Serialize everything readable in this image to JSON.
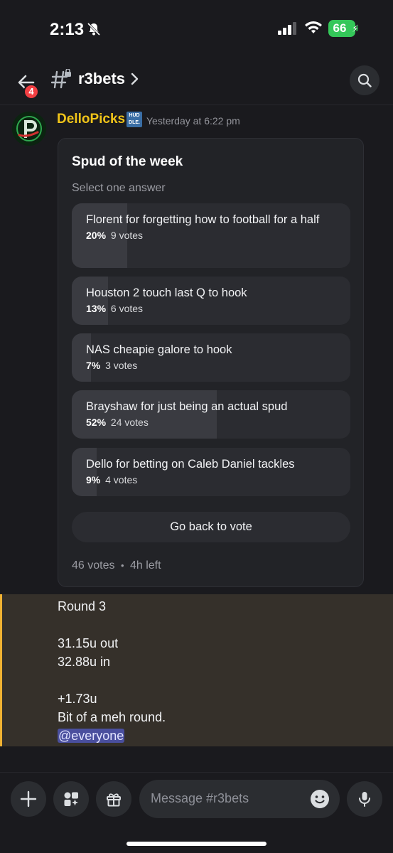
{
  "status_bar": {
    "time": "2:13",
    "battery": "66"
  },
  "header": {
    "back_badge": "4",
    "channel_name": "r3bets"
  },
  "message": {
    "username": "DelloPicks",
    "tag": "HUD DLE",
    "timestamp": "Yesterday at 6:22 pm"
  },
  "poll": {
    "title": "Spud of the week",
    "subtitle": "Select one answer",
    "answers": [
      {
        "text": "Florent for forgetting how to football for a half",
        "percent": "20%",
        "votes": "9 votes",
        "fill": 0.2
      },
      {
        "text": "Houston 2 touch last Q to hook",
        "percent": "13%",
        "votes": "6 votes",
        "fill": 0.13
      },
      {
        "text": "NAS cheapie galore to hook",
        "percent": "7%",
        "votes": "3 votes",
        "fill": 0.07
      },
      {
        "text": "Brayshaw for just being an actual spud",
        "percent": "52%",
        "votes": "24 votes",
        "fill": 0.52
      },
      {
        "text": "Dello for betting on Caleb Daniel tackles",
        "percent": "9%",
        "votes": "4 votes",
        "fill": 0.09
      }
    ],
    "go_back_label": "Go back to vote",
    "total_votes": "46 votes",
    "separator": "•",
    "time_left": "4h left"
  },
  "mention_message": {
    "lines": [
      "Round 3",
      "",
      "31.15u out",
      "32.88u in",
      "",
      "+1.73u",
      "Bit of a meh round."
    ],
    "mention": "@everyone"
  },
  "composer": {
    "placeholder": "Message #r3bets"
  },
  "colors": {
    "username": "#f0c419",
    "mention_bar": "#f0b232",
    "badge": "#f23f43",
    "battery": "#34c759"
  }
}
